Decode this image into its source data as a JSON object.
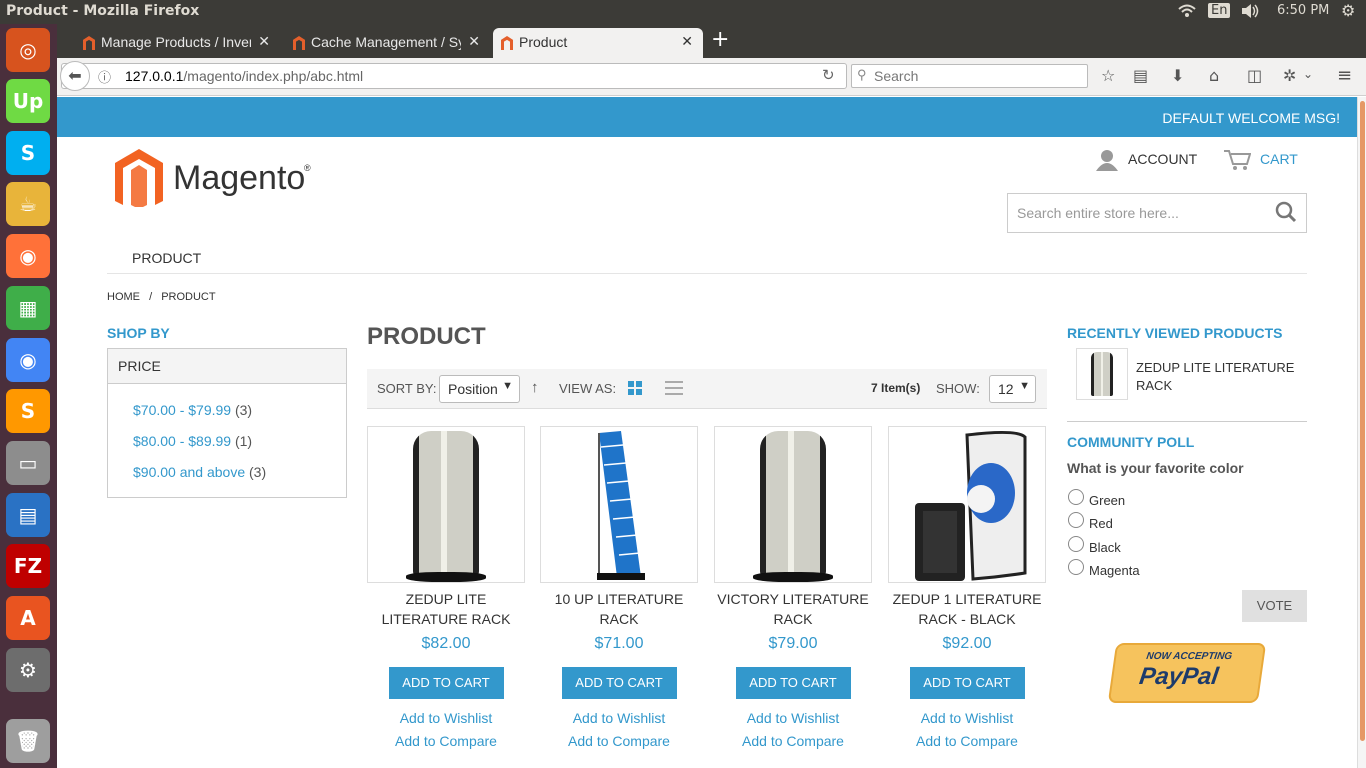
{
  "os": {
    "window_title": "Product - Mozilla Firefox",
    "keyboard_layout": "En",
    "time": "6:50 PM"
  },
  "launcher": [
    {
      "name": "ubuntu-icon",
      "color": "#d7531e"
    },
    {
      "name": "upwork-icon",
      "color": "#6fda44"
    },
    {
      "name": "skype-icon",
      "color": "#00aff0"
    },
    {
      "name": "teapot-icon",
      "color": "#e8b43a"
    },
    {
      "name": "firefox-icon",
      "color": "#ff7139"
    },
    {
      "name": "calc-icon",
      "color": "#3fae49"
    },
    {
      "name": "chrome-icon",
      "color": "#4285f4"
    },
    {
      "name": "sublime-icon",
      "color": "#ff9800"
    },
    {
      "name": "files-icon",
      "color": "#8d8d8d"
    },
    {
      "name": "writer-icon",
      "color": "#2a72c4"
    },
    {
      "name": "filezilla-icon",
      "color": "#bf0000"
    },
    {
      "name": "software-center-icon",
      "color": "#e95420"
    },
    {
      "name": "settings-icon",
      "color": "#6d6d6d"
    },
    {
      "name": "trash-icon",
      "color": "#9e9e9e"
    }
  ],
  "browser": {
    "tabs": [
      {
        "label": "Manage Products / Inventor",
        "active": false
      },
      {
        "label": "Cache Management / System",
        "active": false
      },
      {
        "label": "Product",
        "active": true
      }
    ],
    "url_host": "127.0.0.1",
    "url_path": "/magento/index.php/abc.html",
    "search_placeholder": "Search"
  },
  "store": {
    "welcome": "DEFAULT WELCOME MSG!",
    "brand": "Magento",
    "account_label": "ACCOUNT",
    "cart_label": "CART",
    "search_placeholder": "Search entire store here...",
    "nav_item": "PRODUCT",
    "breadcrumb": {
      "home": "HOME",
      "sep": "/",
      "current": "PRODUCT"
    },
    "shop_by": "SHOP BY",
    "filter": {
      "title": "PRICE",
      "items": [
        {
          "label": "$70.00 - $79.99",
          "count": "(3)"
        },
        {
          "label": "$80.00 - $89.99",
          "count": "(1)"
        },
        {
          "label": "$90.00 and above",
          "count": "(3)"
        }
      ]
    },
    "page_title": "PRODUCT",
    "toolbar": {
      "sort_label": "SORT BY:",
      "sort_value": "Position",
      "view_label": "VIEW AS:",
      "items": "7 Item(s)",
      "show_label": "SHOW:",
      "show_value": "12"
    },
    "products": [
      {
        "name": "ZEDUP LITE LITERATURE RACK",
        "price": "$82.00",
        "cart": "ADD TO CART",
        "wishlist": "Add to Wishlist",
        "compare": "Add to Compare"
      },
      {
        "name": "10 UP LITERATURE RACK",
        "price": "$71.00",
        "cart": "ADD TO CART",
        "wishlist": "Add to Wishlist",
        "compare": "Add to Compare"
      },
      {
        "name": "VICTORY LITERATURE RACK",
        "price": "$79.00",
        "cart": "ADD TO CART",
        "wishlist": "Add to Wishlist",
        "compare": "Add to Compare"
      },
      {
        "name": "ZEDUP 1 LITERATURE RACK - BLACK",
        "price": "$92.00",
        "cart": "ADD TO CART",
        "wishlist": "Add to Wishlist",
        "compare": "Add to Compare"
      }
    ],
    "recently_viewed": {
      "title": "RECENTLY VIEWED PRODUCTS",
      "item": "ZEDUP LITE LITERATURE RACK"
    },
    "poll": {
      "title": "COMMUNITY POLL",
      "question": "What is your favorite color",
      "options": [
        "Green",
        "Red",
        "Black",
        "Magenta"
      ],
      "vote": "VOTE"
    },
    "paypal": {
      "line1": "NOW ACCEPTING",
      "line2": "PayPal"
    },
    "accent_color": "#3398cc",
    "logo_color": "#f26322"
  }
}
